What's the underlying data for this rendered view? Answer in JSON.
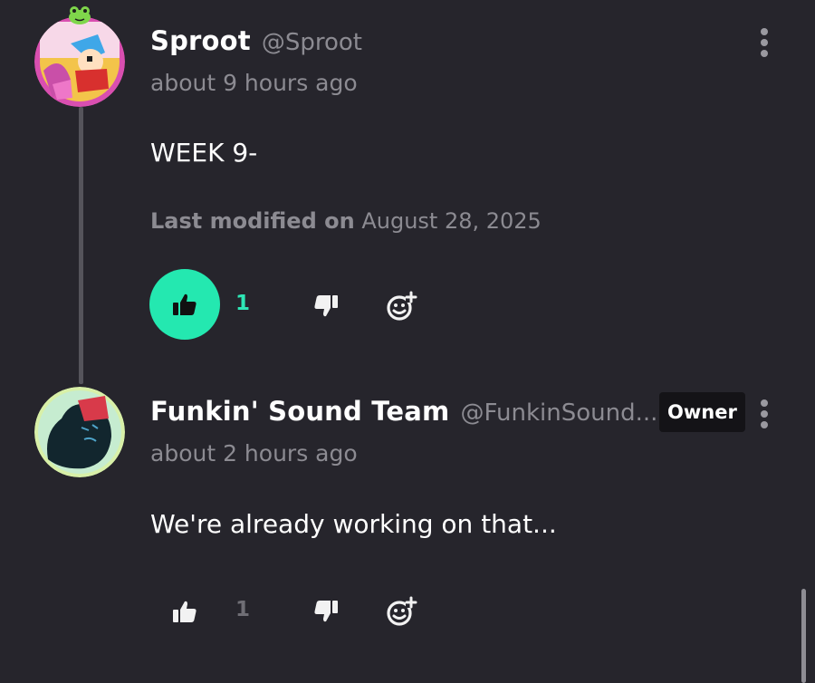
{
  "comments": [
    {
      "display_name": "Sproot",
      "username": "@Sproot",
      "timestamp": "about 9 hours ago",
      "body": "WEEK 9-",
      "modified_label": "Last modified on",
      "modified_date": "August 28, 2025",
      "like_count": "1",
      "liked": true,
      "icons": [
        "thumbs-up-icon",
        "thumbs-down-icon",
        "add-reaction-icon",
        "more-vertical-icon"
      ]
    },
    {
      "display_name": "Funkin' Sound Team",
      "username": "@FunkinSound...",
      "badge": "Owner",
      "timestamp": "about 2 hours ago",
      "body": "We're already working on that...",
      "like_count": "1",
      "liked": false,
      "icons": [
        "thumbs-up-icon",
        "thumbs-down-icon",
        "add-reaction-icon",
        "more-vertical-icon"
      ]
    }
  ],
  "colors": {
    "background": "#26252c",
    "accent": "#24e8b0",
    "muted_text": "#8c8b92",
    "badge_bg": "#141317"
  }
}
